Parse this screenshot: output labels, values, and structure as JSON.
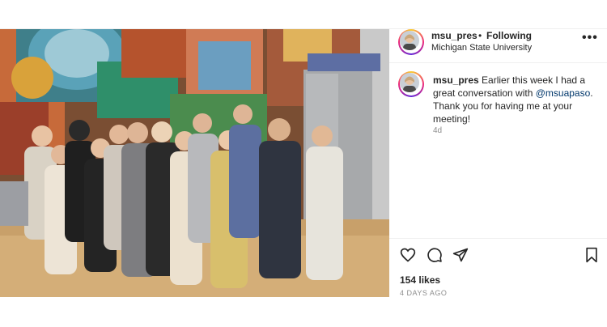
{
  "post": {
    "username": "msu_pres",
    "separator": "•",
    "follow_status": "Following",
    "location": "Michigan State University",
    "more_label": "•••",
    "caption": {
      "username": "msu_pres",
      "text_before": "Earlier this week I had a great conversation with ",
      "mention": "@msuapaso",
      "text_after": ". Thank you for having me at your meeting!",
      "age": "4d"
    },
    "likes": "154 likes",
    "timestamp": "4 DAYS AGO",
    "icons": [
      "heart-icon",
      "comment-icon",
      "share-icon",
      "bookmark-icon",
      "more-icon"
    ],
    "colors": {
      "text": "#262626",
      "muted": "#8e8e8e",
      "mention": "#00376b",
      "divider": "#efefef"
    }
  }
}
